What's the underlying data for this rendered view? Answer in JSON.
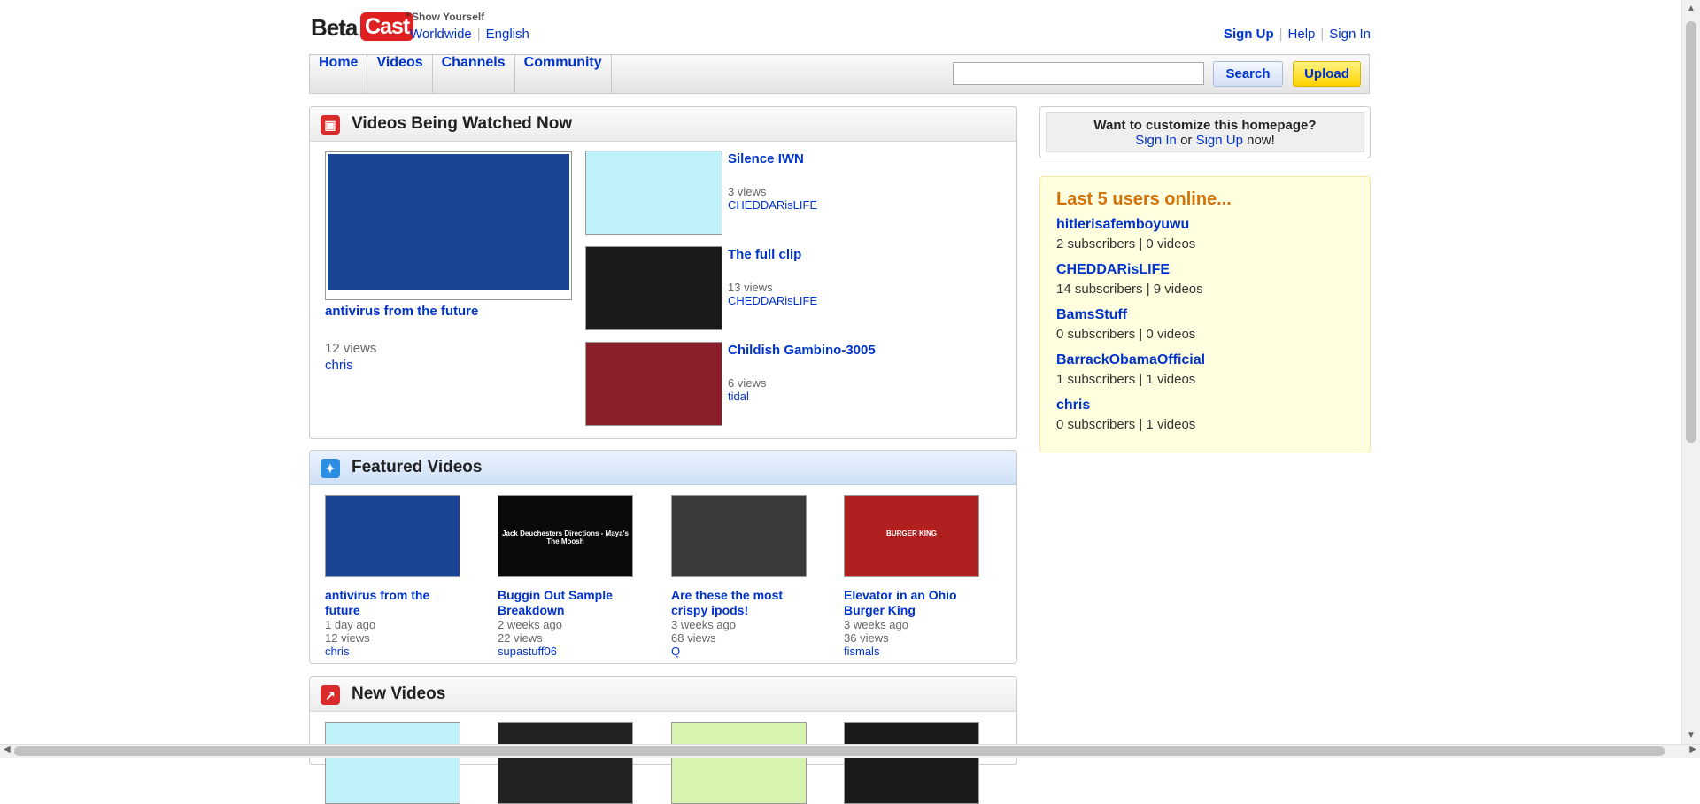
{
  "header": {
    "logo_beta": "Beta",
    "logo_cast": "Cast",
    "logo_tm": "®",
    "tagline": "Show Yourself",
    "locale": [
      "Worldwide",
      "English"
    ],
    "links": [
      "Sign Up",
      "Help",
      "Sign In"
    ]
  },
  "nav": {
    "tabs": [
      "Home",
      "Videos",
      "Channels",
      "Community"
    ],
    "search_value": "",
    "search_label": "Search",
    "upload_label": "Upload"
  },
  "watched_now": {
    "title": "Videos Being Watched Now",
    "main": {
      "title": "antivirus from the future",
      "views": "12 views",
      "user": "chris",
      "thumb_color": "#1b4592"
    },
    "items": [
      {
        "title": "Silence IWN",
        "views": "3 views",
        "user": "CHEDDARisLIFE",
        "thumb_color": "#bff2f8"
      },
      {
        "title": "The full clip",
        "views": "13 views",
        "user": "CHEDDARisLIFE",
        "thumb_color": "#1a1a1a"
      },
      {
        "title": "Childish Gambino-3005",
        "views": "6 views",
        "user": "tidal",
        "thumb_color": "#8a1e2a"
      }
    ]
  },
  "featured": {
    "title": "Featured Videos",
    "items": [
      {
        "title": "antivirus from the future",
        "age": "1 day ago",
        "views": "12 views",
        "user": "chris",
        "thumb_color": "#1b4592"
      },
      {
        "title": "Buggin Out Sample Breakdown",
        "age": "2 weeks ago",
        "views": "22 views",
        "user": "supastuff06",
        "thumb_color": "#0a0a0a",
        "thumb_caption": "Jack Deuchesters Directions - Maya's The Moosh"
      },
      {
        "title": "Are these the most crispy ipods!",
        "age": "3 weeks ago",
        "views": "68 views",
        "user": "Q",
        "thumb_color": "#3a3a3a"
      },
      {
        "title": "Elevator in an Ohio Burger King",
        "age": "3 weeks ago",
        "views": "36 views",
        "user": "fismals",
        "thumb_color": "#b02020",
        "thumb_caption": "BURGER KING"
      }
    ]
  },
  "new_videos": {
    "title": "New Videos",
    "thumb_colors": [
      "#bff2f8",
      "#222222",
      "#d8f2b0",
      "#1a1a1a"
    ]
  },
  "customize": {
    "question": "Want to customize this homepage?",
    "sign_in": "Sign In",
    "or": "or",
    "sign_up": "Sign Up",
    "now": "now!"
  },
  "users_online": {
    "title": "Last 5 users online...",
    "users": [
      {
        "name": "hitlerisafemboyuwu",
        "stats": "2 subscribers | 0 videos"
      },
      {
        "name": "CHEDDARisLIFE",
        "stats": "14 subscribers | 9 videos"
      },
      {
        "name": "BamsStuff",
        "stats": "0 subscribers | 0 videos"
      },
      {
        "name": "BarrackObamaOfficial",
        "stats": "1 subscribers | 1 videos"
      },
      {
        "name": "chris",
        "stats": "0 subscribers | 1 videos"
      }
    ]
  }
}
